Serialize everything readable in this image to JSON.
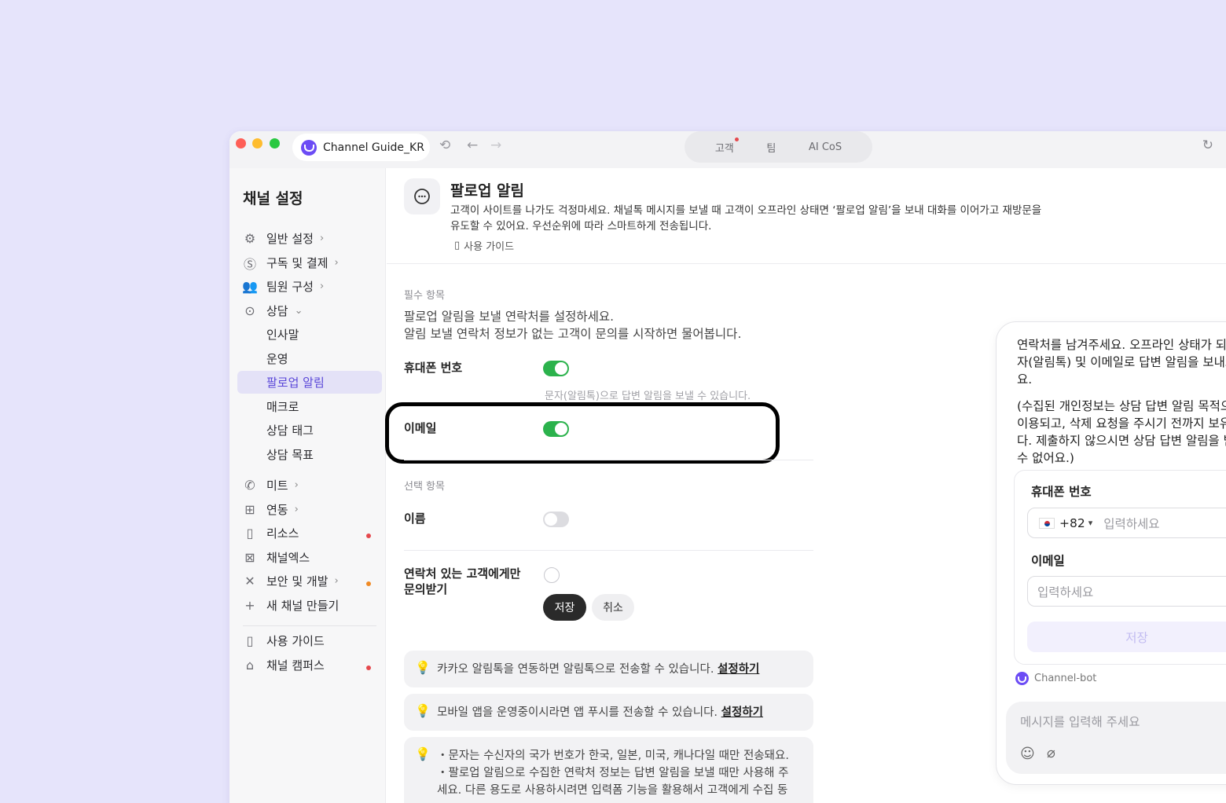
{
  "titlebar": {
    "channel_name": "Channel Guide_KR",
    "tabs": [
      "고객",
      "팀",
      "AI CoS"
    ]
  },
  "sidebar": {
    "title": "채널 설정",
    "items": [
      {
        "label": "일반 설정",
        "icon": "gear-icon"
      },
      {
        "label": "구독 및 결제",
        "icon": "dollar-icon"
      },
      {
        "label": "팀원 구성",
        "icon": "people-icon"
      },
      {
        "label": "상담",
        "icon": "chat-icon"
      },
      {
        "label": "인사말"
      },
      {
        "label": "운영"
      },
      {
        "label": "팔로업 알림"
      },
      {
        "label": "매크로"
      },
      {
        "label": "상담 태그"
      },
      {
        "label": "상담 목표"
      },
      {
        "label": "미트",
        "icon": "phone-icon"
      },
      {
        "label": "연동",
        "icon": "grid-icon"
      },
      {
        "label": "리소스",
        "icon": "book-icon"
      },
      {
        "label": "채널엑스",
        "icon": "channelx-icon"
      },
      {
        "label": "보안 및 개발",
        "icon": "tools-icon"
      },
      {
        "label": "새 채널 만들기",
        "icon": "plus-icon"
      },
      {
        "label": "사용 가이드",
        "icon": "book-icon"
      },
      {
        "label": "채널 캠퍼스",
        "icon": "graduation-cap-icon"
      }
    ],
    "dot_colors": {
      "red": "#e5484d",
      "orange": "#f08a24"
    }
  },
  "header": {
    "title": "팔로업 알림",
    "description_line1": "고객이 사이트를 나가도 걱정마세요. 채널톡 메시지를 보낼 때 고객이 오프라인 상태면 ‘팔로업 알림’을 보내 대화를 이어가고 재방문을",
    "description_line2": "유도할 수 있어요. 우선순위에 따라 스마트하게 전송됩니다.",
    "guide_link": "사용 가이드"
  },
  "form": {
    "required_label": "필수 항목",
    "required_desc_line1": "팔로업 알림을 보낼 연락처를 설정하세요.",
    "required_desc_line2": "알림 보낼 연락처 정보가 없는 고객이 문의를 시작하면 물어봅니다.",
    "phone_label": "휴대폰 번호",
    "phone_enabled": true,
    "phone_hint": "문자(알림톡)으로 답변 알림을 보낼 수 있습니다.",
    "email_label": "이메일",
    "email_enabled": true,
    "optional_label": "선택 항목",
    "name_label": "이름",
    "name_enabled": false,
    "contact_only_line1": "연락처 있는 고객에게만",
    "contact_only_line2": "문의받기",
    "contact_only_checked": false,
    "save_label": "저장",
    "cancel_label": "취소"
  },
  "tips": [
    {
      "text": "카카오 알림톡을 연동하면 알림톡으로 전송할 수 있습니다.",
      "link": "설정하기"
    },
    {
      "text": "모바일 앱을 운영중이시라면 앱 푸시를 전송할 수 있습니다.",
      "link": "설정하기"
    },
    {
      "line1": "・문자는 수신자의 국가 번호가 한국, 일본, 미국, 캐나다일 때만 전송돼요.",
      "line2": "・팔로업 알림으로 수집한 연락처 정보는 답변 알림을 보낼 때만 사용해 주",
      "line3": "세요. 다른 용도로 사용하시려면 입력폼 기능을 활용해서 고객에게 수집 동"
    }
  ],
  "preview": {
    "message1": "연락처를 남겨주세요. 오프라인 상태가 되면 문자(알림톡) 및 이메일로 답변 알림을 보내드려요.",
    "message2": "(수집된 개인정보는 상담 답변 알림 목적으로만 이용되고, 삭제 요청을 주시기 전까지 보유됩니다. 제출하지 않으시면 상담 답변 알림을 받을 수 없어요.)",
    "phone_label": "휴대폰 번호",
    "country_code": "+82",
    "phone_placeholder": "입력하세요",
    "email_label": "이메일",
    "email_placeholder": "입력하세요",
    "save_label": "저장",
    "bot_name": "Channel-bot",
    "compose_placeholder": "메시지를 입력해 주세요"
  },
  "colors": {
    "accent": "#6c4cf5",
    "toggle_on": "#2bb24c",
    "background": "#e6e4fb"
  }
}
